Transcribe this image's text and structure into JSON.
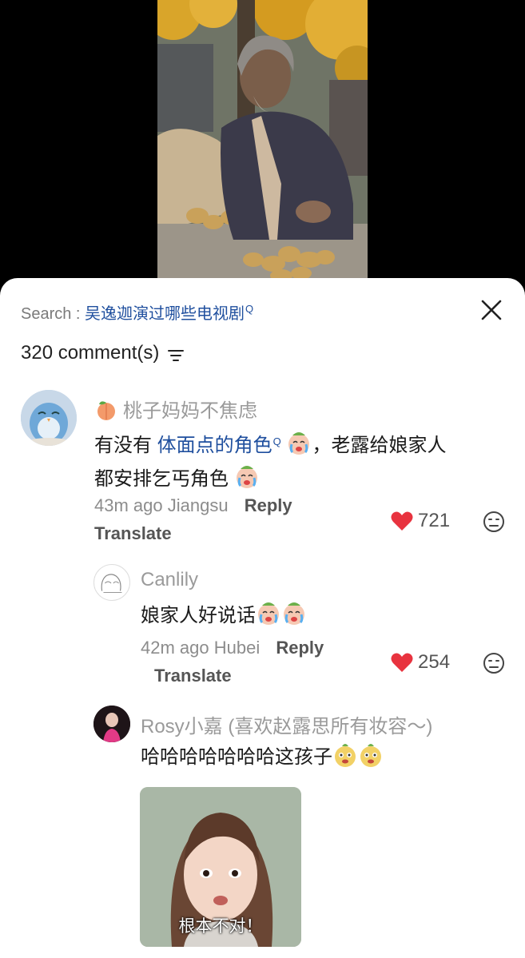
{
  "search": {
    "label": "Search : ",
    "query": "吴逸迦演过哪些电视剧"
  },
  "comments_count": "320 comment(s)",
  "comments": [
    {
      "username": "桃子妈妈不焦虑",
      "badge_icon": "peach-emoji",
      "text_pre": "有没有 ",
      "text_link": "体面点的角色",
      "text_post_line1": "，老露给娘家人",
      "text_line2": "都安排乞丐角色",
      "emoji": "crying-emoji",
      "time": "43m ago",
      "location": "Jiangsu",
      "reply_label": "Reply",
      "translate_label": "Translate",
      "likes": "721",
      "like_color": "#e8333f"
    },
    {
      "username": "Canlily",
      "text": "娘家人好说话",
      "emoji": "crying-emoji",
      "time": "42m ago",
      "location": "Hubei",
      "reply_label": "Reply",
      "translate_label": "Translate",
      "likes": "254"
    },
    {
      "username": "Rosy小嘉 (喜欢赵露思所有妆容～)",
      "text": "哈哈哈哈哈哈哈这孩子",
      "emoji": "funny-face-emoji",
      "sticker_caption": "根本不对！"
    }
  ]
}
